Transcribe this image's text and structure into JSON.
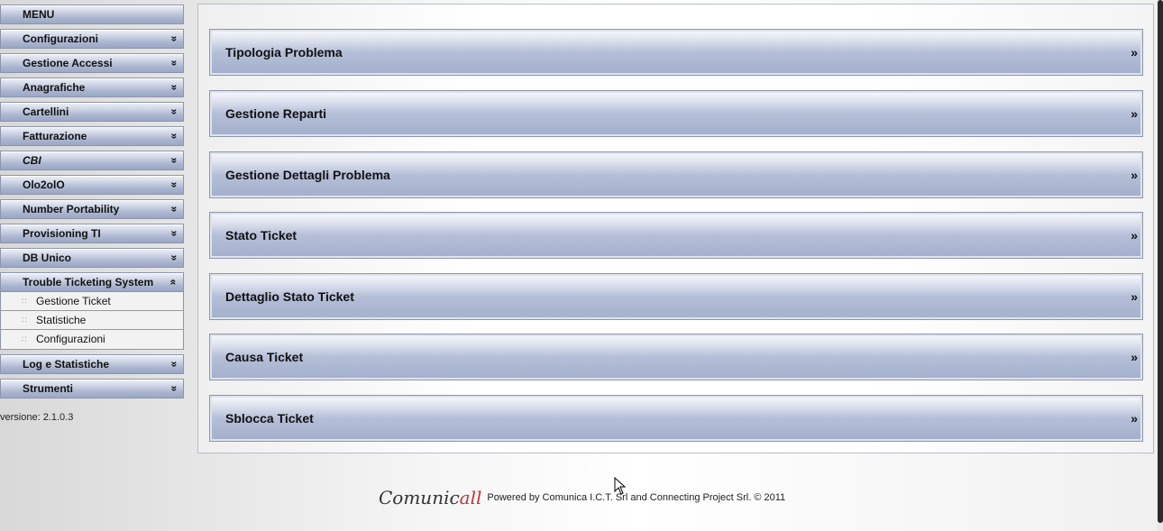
{
  "sidebar": {
    "header": "MENU",
    "items": [
      {
        "label": "Configurazioni",
        "chev": "»"
      },
      {
        "label": "Gestione Accessi",
        "chev": "»"
      },
      {
        "label": "Anagrafiche",
        "chev": "»"
      },
      {
        "label": "Cartellini",
        "chev": "»"
      },
      {
        "label": "Fatturazione",
        "chev": "»"
      },
      {
        "label": "CBI",
        "chev": "»"
      },
      {
        "label": "Olo2olO",
        "chev": "»"
      },
      {
        "label": "Number Portability",
        "chev": "»"
      },
      {
        "label": "Provisioning TI",
        "chev": "»"
      },
      {
        "label": "DB Unico",
        "chev": "»"
      },
      {
        "label": "Trouble Ticketing System",
        "chev": "«"
      },
      {
        "label": "Log e Statistiche",
        "chev": "»"
      },
      {
        "label": "Strumenti",
        "chev": "»"
      }
    ],
    "submenu": [
      {
        "label": "Gestione Ticket"
      },
      {
        "label": "Statistiche"
      },
      {
        "label": "Configurazioni"
      }
    ],
    "version": "versione: 2.1.0.3"
  },
  "main": {
    "rows": [
      {
        "label": "Tipologia Problema",
        "raq": "»"
      },
      {
        "label": "Gestione Reparti",
        "raq": "»"
      },
      {
        "label": "Gestione Dettagli Problema",
        "raq": "»"
      },
      {
        "label": "Stato Ticket",
        "raq": "»"
      },
      {
        "label": "Dettaglio Stato Ticket",
        "raq": "»"
      },
      {
        "label": "Causa Ticket",
        "raq": "»"
      },
      {
        "label": "Sblocca Ticket",
        "raq": "»"
      }
    ]
  },
  "footer": {
    "logo_text": "Comunic",
    "logo_swash": "all",
    "powered_by": "Powered by",
    "company1": "Comunica I.C.T. Srl",
    "and": "and",
    "company2": "Connecting Project Srl.",
    "copyright": "© 2011"
  }
}
